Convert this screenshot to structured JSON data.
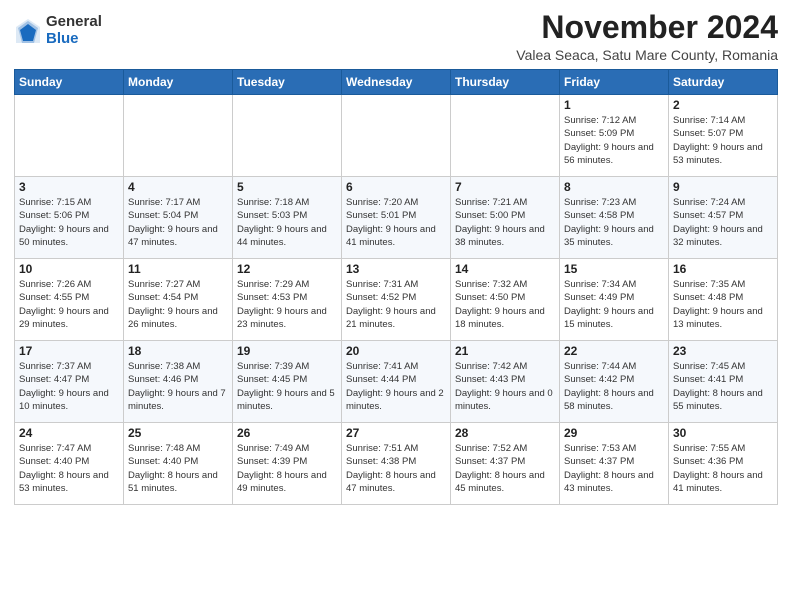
{
  "header": {
    "logo_general": "General",
    "logo_blue": "Blue",
    "month_title": "November 2024",
    "subtitle": "Valea Seaca, Satu Mare County, Romania"
  },
  "days_of_week": [
    "Sunday",
    "Monday",
    "Tuesday",
    "Wednesday",
    "Thursday",
    "Friday",
    "Saturday"
  ],
  "weeks": [
    [
      {
        "day": "",
        "info": ""
      },
      {
        "day": "",
        "info": ""
      },
      {
        "day": "",
        "info": ""
      },
      {
        "day": "",
        "info": ""
      },
      {
        "day": "",
        "info": ""
      },
      {
        "day": "1",
        "info": "Sunrise: 7:12 AM\nSunset: 5:09 PM\nDaylight: 9 hours and 56 minutes."
      },
      {
        "day": "2",
        "info": "Sunrise: 7:14 AM\nSunset: 5:07 PM\nDaylight: 9 hours and 53 minutes."
      }
    ],
    [
      {
        "day": "3",
        "info": "Sunrise: 7:15 AM\nSunset: 5:06 PM\nDaylight: 9 hours and 50 minutes."
      },
      {
        "day": "4",
        "info": "Sunrise: 7:17 AM\nSunset: 5:04 PM\nDaylight: 9 hours and 47 minutes."
      },
      {
        "day": "5",
        "info": "Sunrise: 7:18 AM\nSunset: 5:03 PM\nDaylight: 9 hours and 44 minutes."
      },
      {
        "day": "6",
        "info": "Sunrise: 7:20 AM\nSunset: 5:01 PM\nDaylight: 9 hours and 41 minutes."
      },
      {
        "day": "7",
        "info": "Sunrise: 7:21 AM\nSunset: 5:00 PM\nDaylight: 9 hours and 38 minutes."
      },
      {
        "day": "8",
        "info": "Sunrise: 7:23 AM\nSunset: 4:58 PM\nDaylight: 9 hours and 35 minutes."
      },
      {
        "day": "9",
        "info": "Sunrise: 7:24 AM\nSunset: 4:57 PM\nDaylight: 9 hours and 32 minutes."
      }
    ],
    [
      {
        "day": "10",
        "info": "Sunrise: 7:26 AM\nSunset: 4:55 PM\nDaylight: 9 hours and 29 minutes."
      },
      {
        "day": "11",
        "info": "Sunrise: 7:27 AM\nSunset: 4:54 PM\nDaylight: 9 hours and 26 minutes."
      },
      {
        "day": "12",
        "info": "Sunrise: 7:29 AM\nSunset: 4:53 PM\nDaylight: 9 hours and 23 minutes."
      },
      {
        "day": "13",
        "info": "Sunrise: 7:31 AM\nSunset: 4:52 PM\nDaylight: 9 hours and 21 minutes."
      },
      {
        "day": "14",
        "info": "Sunrise: 7:32 AM\nSunset: 4:50 PM\nDaylight: 9 hours and 18 minutes."
      },
      {
        "day": "15",
        "info": "Sunrise: 7:34 AM\nSunset: 4:49 PM\nDaylight: 9 hours and 15 minutes."
      },
      {
        "day": "16",
        "info": "Sunrise: 7:35 AM\nSunset: 4:48 PM\nDaylight: 9 hours and 13 minutes."
      }
    ],
    [
      {
        "day": "17",
        "info": "Sunrise: 7:37 AM\nSunset: 4:47 PM\nDaylight: 9 hours and 10 minutes."
      },
      {
        "day": "18",
        "info": "Sunrise: 7:38 AM\nSunset: 4:46 PM\nDaylight: 9 hours and 7 minutes."
      },
      {
        "day": "19",
        "info": "Sunrise: 7:39 AM\nSunset: 4:45 PM\nDaylight: 9 hours and 5 minutes."
      },
      {
        "day": "20",
        "info": "Sunrise: 7:41 AM\nSunset: 4:44 PM\nDaylight: 9 hours and 2 minutes."
      },
      {
        "day": "21",
        "info": "Sunrise: 7:42 AM\nSunset: 4:43 PM\nDaylight: 9 hours and 0 minutes."
      },
      {
        "day": "22",
        "info": "Sunrise: 7:44 AM\nSunset: 4:42 PM\nDaylight: 8 hours and 58 minutes."
      },
      {
        "day": "23",
        "info": "Sunrise: 7:45 AM\nSunset: 4:41 PM\nDaylight: 8 hours and 55 minutes."
      }
    ],
    [
      {
        "day": "24",
        "info": "Sunrise: 7:47 AM\nSunset: 4:40 PM\nDaylight: 8 hours and 53 minutes."
      },
      {
        "day": "25",
        "info": "Sunrise: 7:48 AM\nSunset: 4:40 PM\nDaylight: 8 hours and 51 minutes."
      },
      {
        "day": "26",
        "info": "Sunrise: 7:49 AM\nSunset: 4:39 PM\nDaylight: 8 hours and 49 minutes."
      },
      {
        "day": "27",
        "info": "Sunrise: 7:51 AM\nSunset: 4:38 PM\nDaylight: 8 hours and 47 minutes."
      },
      {
        "day": "28",
        "info": "Sunrise: 7:52 AM\nSunset: 4:37 PM\nDaylight: 8 hours and 45 minutes."
      },
      {
        "day": "29",
        "info": "Sunrise: 7:53 AM\nSunset: 4:37 PM\nDaylight: 8 hours and 43 minutes."
      },
      {
        "day": "30",
        "info": "Sunrise: 7:55 AM\nSunset: 4:36 PM\nDaylight: 8 hours and 41 minutes."
      }
    ]
  ]
}
